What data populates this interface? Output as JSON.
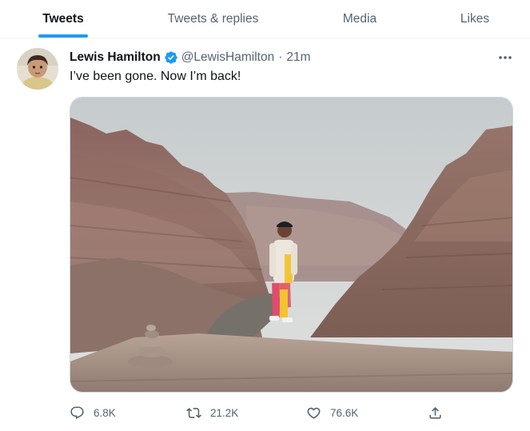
{
  "tabs": [
    {
      "label": "Tweets",
      "active": true
    },
    {
      "label": "Tweets & replies",
      "active": false
    },
    {
      "label": "Media",
      "active": false
    },
    {
      "label": "Likes",
      "active": false
    }
  ],
  "tweet": {
    "display_name": "Lewis Hamilton",
    "verified": true,
    "handle": "@LewisHamilton",
    "separator": "·",
    "time": "21m",
    "text": "I’ve been gone. Now I’m back!",
    "stats": {
      "replies": "6.8K",
      "retweets": "21.2K",
      "likes": "76.6K"
    }
  },
  "icons": {
    "verified": "verified-badge-icon",
    "more": "more-horizontal-icon",
    "reply": "reply-icon",
    "retweet": "retweet-icon",
    "like": "heart-icon",
    "share": "share-icon"
  },
  "colors": {
    "accent": "#1d9bf0",
    "text_primary": "#0f1419",
    "text_secondary": "#536471",
    "divider": "#eff3f4"
  }
}
